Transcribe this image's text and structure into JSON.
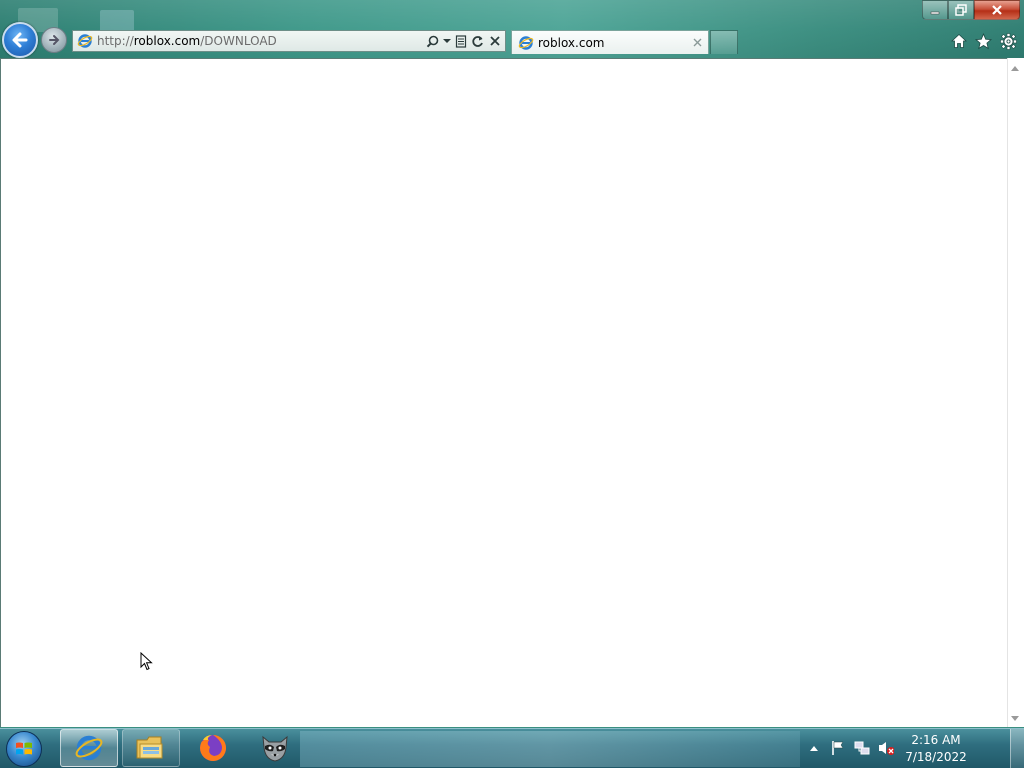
{
  "browser": {
    "address": {
      "scheme": "http://",
      "host": "roblox.com",
      "path": "/DOWNLOAD"
    },
    "tabs": [
      {
        "title": "roblox.com",
        "icon": "ie-icon"
      }
    ],
    "address_tools": [
      "search-icon",
      "dropdown-icon",
      "compatibility-view-icon",
      "refresh-icon",
      "stop-icon"
    ],
    "right_icons": [
      "home-icon",
      "favorites-star-icon",
      "gear-icon"
    ]
  },
  "taskbar": {
    "pinned": [
      {
        "name": "internet-explorer",
        "icon": "ie-icon",
        "active": true
      },
      {
        "name": "windows-explorer",
        "icon": "folder-icon",
        "active": false
      },
      {
        "name": "firefox",
        "icon": "firefox-icon",
        "active": false
      },
      {
        "name": "raccoon-app",
        "icon": "raccoon-icon",
        "active": false
      }
    ],
    "tray_icons": [
      "show-hidden-icons-arrow",
      "action-center-flag-icon",
      "network-icon",
      "volume-muted-icon"
    ],
    "clock": {
      "time": "2:16 AM",
      "date": "7/18/2022"
    }
  },
  "colors": {
    "frame": "#3b9c8c",
    "taskbar": "#2f6e7f",
    "close_button": "#c8503a"
  }
}
